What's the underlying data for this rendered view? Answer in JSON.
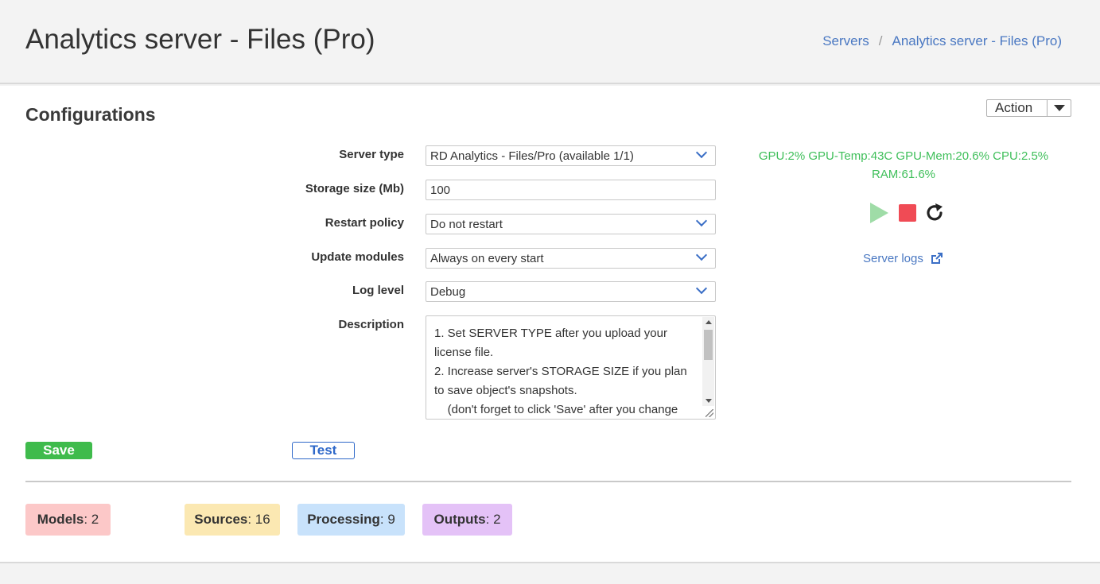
{
  "header": {
    "title": "Analytics server - Files (Pro)",
    "breadcrumb": [
      {
        "label": "Servers"
      },
      {
        "label": "Analytics server - Files (Pro)"
      }
    ],
    "breadcrumb_separator": "/"
  },
  "config": {
    "section_title": "Configurations",
    "action_label": "Action",
    "fields": {
      "server_type": {
        "label": "Server type",
        "value": "RD Analytics - Files/Pro (available 1/1)"
      },
      "storage_size": {
        "label": "Storage size (Mb)",
        "value": "100"
      },
      "restart_policy": {
        "label": "Restart policy",
        "value": "Do not restart"
      },
      "update_modules": {
        "label": "Update modules",
        "value": "Always on every start"
      },
      "log_level": {
        "label": "Log level",
        "value": "Debug"
      },
      "description": {
        "label": "Description",
        "lines": [
          "1. Set SERVER TYPE after you upload your license file.",
          "2. Increase server's STORAGE SIZE if you plan to save object's snapshots.",
          "    (don't forget to click 'Save' after you change"
        ]
      }
    },
    "save_label": "Save",
    "test_label": "Test"
  },
  "status": {
    "stats_line1": "GPU:2% GPU-Temp:43C GPU-Mem:20.6% CPU:2.5%",
    "stats_line2": "RAM:61.6%",
    "server_logs_label": "Server logs",
    "colors": {
      "stats": "#3fbf5a",
      "play": "#9fdca7",
      "stop": "#f04b55"
    }
  },
  "badges": [
    {
      "label": "Models",
      "count": ": 2",
      "color": "#fcc8c8"
    },
    {
      "label": "Sources",
      "count": ": 16",
      "color": "#fbe8b2"
    },
    {
      "label": "Processing",
      "count": ": 9",
      "color": "#c8e2fb"
    },
    {
      "label": "Outputs",
      "count": ": 2",
      "color": "#e4c2f7"
    }
  ]
}
